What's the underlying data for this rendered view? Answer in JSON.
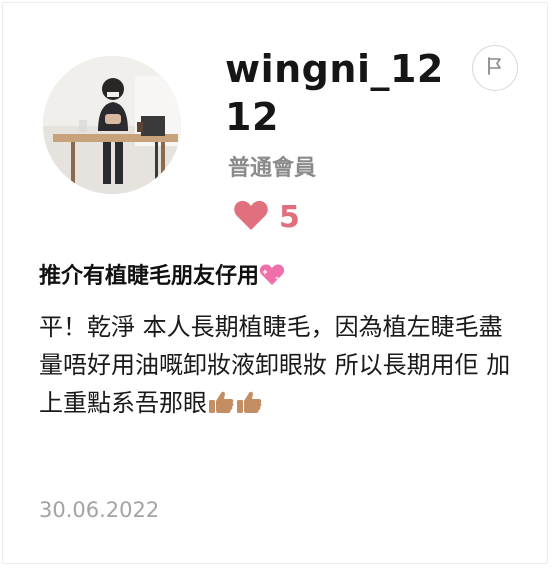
{
  "review": {
    "username": "wingni_1212",
    "member_type": "普通會員",
    "likes": "5",
    "title": "推介有植睫毛朋友仔用",
    "body": "平！乾淨 本人長期植睫毛，因為植左睫毛盡量唔好用油嘅卸妝液卸眼妝 所以長期用佢 加上重點系吾那眼",
    "date": "30.06.2022"
  },
  "icons": {
    "flag": "flag-icon",
    "heart": "heart-icon",
    "title_emoji": "sparkling-heart-emoji",
    "body_emoji": "thumbs-up-emoji"
  },
  "colors": {
    "heart": "#e0707e",
    "member": "#8b8b8b",
    "date": "#a3a3a3"
  }
}
